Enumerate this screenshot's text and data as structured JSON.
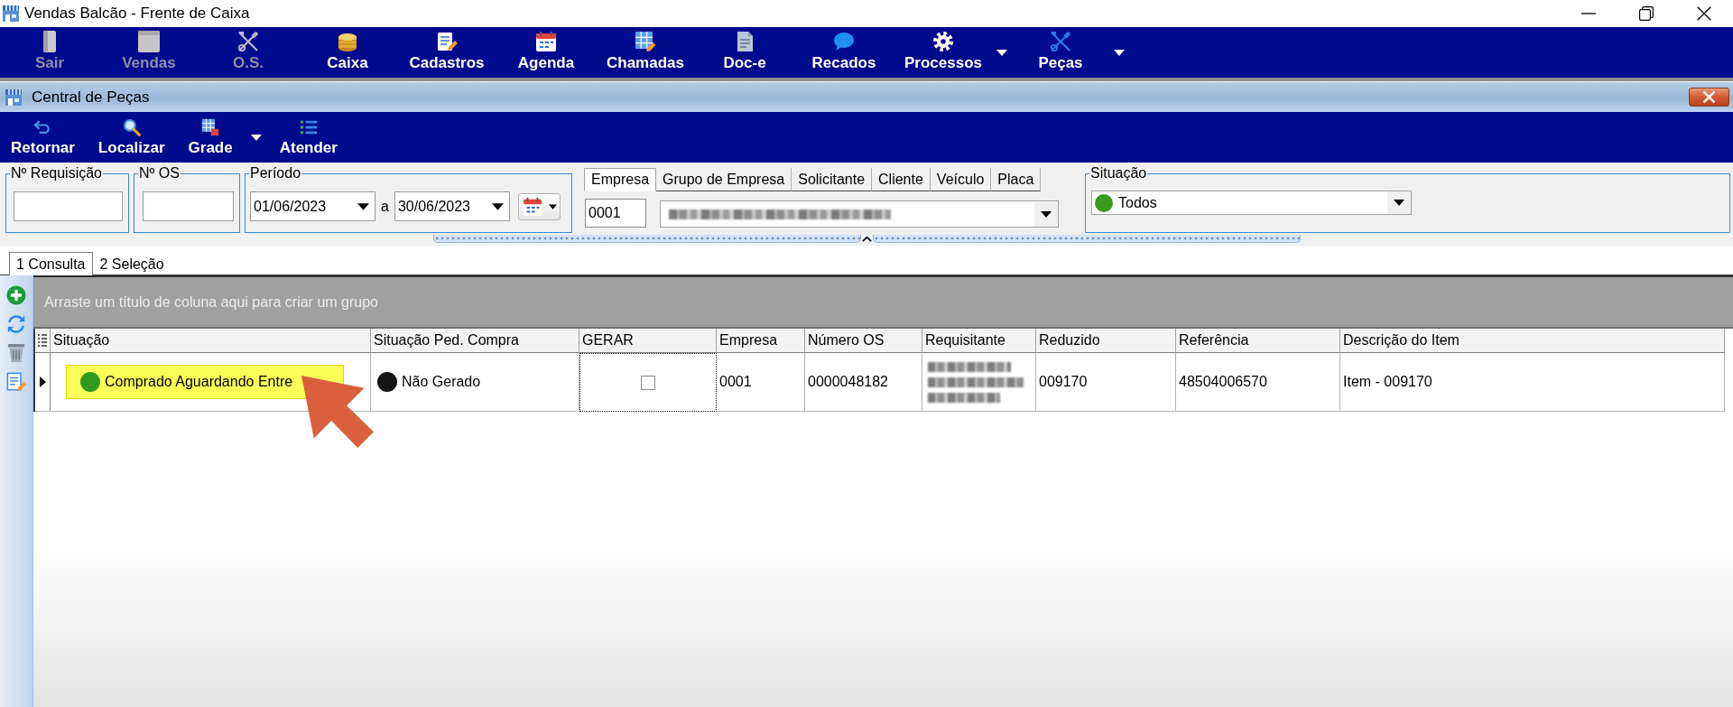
{
  "window": {
    "title": "Vendas Balcão - Frente de Caixa"
  },
  "main_toolbar": [
    {
      "label": "Sair",
      "disabled": true,
      "dropdown": false
    },
    {
      "label": "Vendas",
      "disabled": true,
      "dropdown": false
    },
    {
      "label": "O.S.",
      "disabled": true,
      "dropdown": false
    },
    {
      "label": "Caixa",
      "disabled": false,
      "dropdown": false
    },
    {
      "label": "Cadastros",
      "disabled": false,
      "dropdown": false
    },
    {
      "label": "Agenda",
      "disabled": false,
      "dropdown": false
    },
    {
      "label": "Chamadas",
      "disabled": false,
      "dropdown": false
    },
    {
      "label": "Doc-e",
      "disabled": false,
      "dropdown": false
    },
    {
      "label": "Recados",
      "disabled": false,
      "dropdown": false
    },
    {
      "label": "Processos",
      "disabled": false,
      "dropdown": true
    },
    {
      "label": "Peças",
      "disabled": false,
      "dropdown": true
    }
  ],
  "child_window": {
    "title": "Central de Peças"
  },
  "sub_toolbar": [
    {
      "label": "Retornar",
      "dropdown": false
    },
    {
      "label": "Localizar",
      "dropdown": false
    },
    {
      "label": "Grade",
      "dropdown": true
    },
    {
      "label": "Atender",
      "dropdown": false
    }
  ],
  "filters": {
    "requisicao": {
      "label": "Nº Requisição"
    },
    "numero_os": {
      "label": "Nº OS"
    },
    "periodo": {
      "label": "Período",
      "from": "01/06/2023",
      "between": "a",
      "to": "30/06/2023"
    },
    "empresa": {
      "tabs": [
        {
          "label": "Empresa",
          "selected": true
        },
        {
          "label": "Grupo de Empresa",
          "selected": false
        },
        {
          "label": "Solicitante",
          "selected": false
        },
        {
          "label": "Cliente",
          "selected": false
        },
        {
          "label": "Veículo",
          "selected": false
        },
        {
          "label": "Placa",
          "selected": false
        }
      ],
      "code": "0001",
      "name_redacted": true
    },
    "situacao": {
      "label": "Situação",
      "value": "Todos",
      "color": "#3a9a1e"
    }
  },
  "view_tabs": [
    {
      "label": "1 Consulta",
      "selected": true
    },
    {
      "label": "2 Seleção",
      "selected": false
    }
  ],
  "grid": {
    "group_hint": "Arraste um título de coluna aqui para criar um grupo",
    "columns": [
      "Situação",
      "Situação Ped. Compra",
      "GERAR",
      "Empresa",
      "Número OS",
      "Requisitante",
      "Reduzido",
      "Referência",
      "Descrição do Item"
    ],
    "rows": [
      {
        "current": true,
        "cells": [
          {
            "kind": "status",
            "text": "Comprado Aguardando Entre",
            "color": "#2f9a1c",
            "highlighted": true
          },
          {
            "kind": "status",
            "text": "Não Gerado",
            "color": "#141414",
            "highlighted": false
          },
          {
            "kind": "checkbox",
            "checked": false,
            "focused": true
          },
          {
            "kind": "text",
            "text": "0001"
          },
          {
            "kind": "text",
            "text": "0000048182"
          },
          {
            "kind": "redacted"
          },
          {
            "kind": "text",
            "text": "009170"
          },
          {
            "kind": "text",
            "text": "48504006570"
          },
          {
            "kind": "text",
            "text": "Item - 009170"
          }
        ]
      }
    ]
  }
}
